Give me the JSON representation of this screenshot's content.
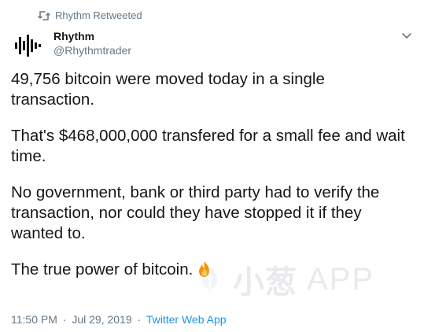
{
  "retweet": {
    "label": "Rhythm Retweeted"
  },
  "author": {
    "name": "Rhythm",
    "handle": "@Rhythmtrader",
    "avatar_icon": "soundwave-logo-icon"
  },
  "tweet": {
    "paragraphs": [
      "49,756 bitcoin were moved today in a single transaction.",
      "That's $468,000,000 transfered for a small fee and wait time.",
      "No government, bank or third party had to verify the transaction, nor could they have stopped it if they wanted to.",
      "The true power of bitcoin."
    ],
    "emoji": "fire-emoji"
  },
  "meta": {
    "time": "11:50 PM",
    "separator": "·",
    "date": "Jul 29, 2019",
    "source": "Twitter Web App"
  },
  "watermark": {
    "text": "小葱",
    "app": "APP"
  },
  "colors": {
    "text": "#14171a",
    "secondary": "#657786",
    "link": "#1b95e0"
  }
}
